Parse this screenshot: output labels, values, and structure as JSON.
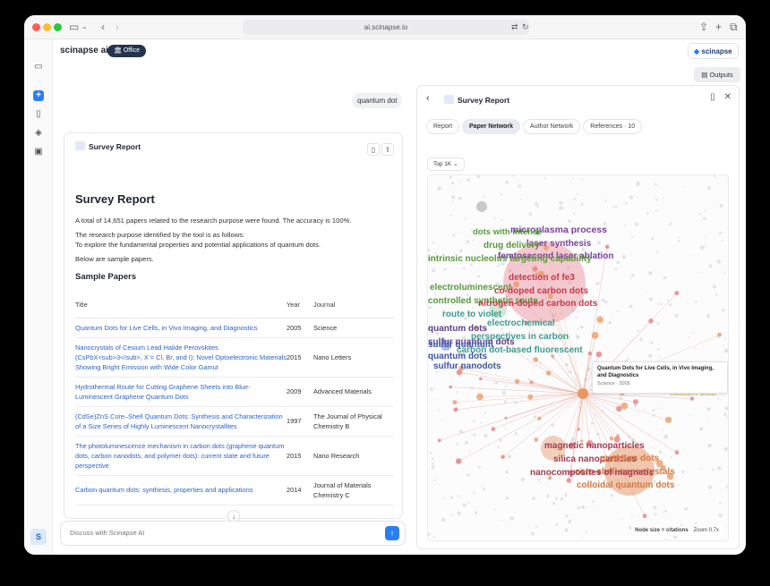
{
  "window": {
    "url": "ai.scinapse.io"
  },
  "header": {
    "brand": "scinapse ai",
    "workspace_badge": "🏛 Office",
    "scinapse_button": "scinapse",
    "outputs_button": "Outputs"
  },
  "rail": {
    "avatar": "S"
  },
  "chat": {
    "query": "quantum dot",
    "card_title": "Survey Report",
    "report": {
      "title": "Survey Report",
      "summary": "A total of 14,651 papers related to the research purpose were found. The accuracy is 100%.",
      "purpose_intro": "The research purpose identified by the tool is as follows:",
      "purpose": "To explore the fundamental properties and potential applications of quantum dots.",
      "below": "Below are sample papers.",
      "sample_title": "Sample Papers",
      "columns": [
        "Title",
        "Year",
        "Journal"
      ],
      "rows": [
        {
          "title": "Quantum Dots for Live Cells, in Vivo Imaging, and Diagnostics",
          "year": "2005",
          "journal": "Science"
        },
        {
          "title": "Nanocrystals of Cesium Lead Halide Perovskites (CsPbX<sub>3</sub>, X = Cl, Br, and I): Novel Optoelectronic Materials Showing Bright Emission with Wide Color Gamut",
          "year": "2015",
          "journal": "Nano Letters"
        },
        {
          "title": "Hydrothermal Route for Cutting Graphene Sheets into Blue-Luminescent Graphene Quantum Dots",
          "year": "2009",
          "journal": "Advanced Materials"
        },
        {
          "title": "(CdSe)ZnS Core–Shell Quantum Dots: Synthesis and Characterization of a Size Series of Highly Luminescent Nanocrystallites",
          "year": "1997",
          "journal": "The Journal of Physical Chemistry B"
        },
        {
          "title": "The photoluminescence mechanism in carbon dots (graphene quantum dots, carbon nanodots, and polymer dots): current state and future perspective",
          "year": "2015",
          "journal": "Nano Research"
        },
        {
          "title": "Carbon quantum dots: synthesis, properties and applications",
          "year": "2014",
          "journal": "Journal of Materials Chemistry C"
        }
      ]
    },
    "composer_placeholder": "Discuss with Scinapse AI"
  },
  "panel": {
    "title": "Survey Report",
    "tabs": [
      "Report",
      "Paper Network",
      "Author Network",
      "References · 10"
    ],
    "active_tab": 1,
    "topk": "Top 1K",
    "graph_labels": [
      {
        "text": "microplasma process",
        "color": "#7b3f9e"
      },
      {
        "text": "dots with intense",
        "color": "#5a9a3a"
      },
      {
        "text": "laser synthesis",
        "color": "#7b3f9e"
      },
      {
        "text": "drug delivery",
        "color": "#5a9a3a"
      },
      {
        "text": "femtosecond laser ablation",
        "color": "#7b3f9e"
      },
      {
        "text": "intrinsic nucleolus targeting capability",
        "color": "#5a9a3a"
      },
      {
        "text": "detection of fe3",
        "color": "#c9394a"
      },
      {
        "text": "electroluminescent",
        "color": "#5a9a3a"
      },
      {
        "text": "co-doped carbon dots",
        "color": "#c9394a"
      },
      {
        "text": "controlled synthetic route",
        "color": "#5a9a3a"
      },
      {
        "text": "nitrogen-doped carbon dots",
        "color": "#c9394a"
      },
      {
        "text": "route to violet",
        "color": "#3f9b8f"
      },
      {
        "text": "electrochemical",
        "color": "#3f9b8f"
      },
      {
        "text": "quantum dots",
        "color": "#5b3f8e"
      },
      {
        "text": "perspectives in carbon",
        "color": "#3f9b8f"
      },
      {
        "text": "sulfur quantum dots",
        "color": "#5b3f8e"
      },
      {
        "text": "carbon dot-based fluorescent",
        "color": "#3f9b8f"
      },
      {
        "text": "sulfur quantum",
        "color": "#3d56a3"
      },
      {
        "text": "quantum dots",
        "color": "#3d56a3"
      },
      {
        "text": "sulfur nanodots",
        "color": "#3d56a3"
      },
      {
        "text": "cesium lead",
        "color": "#d9c66a"
      },
      {
        "text": "perovskite quantum",
        "color": "#d9c66a"
      },
      {
        "text": "lead halide perovskite",
        "color": "#d9c66a"
      },
      {
        "text": "magnetic nanoparticles",
        "color": "#a33a4f"
      },
      {
        "text": "silica nanoparticles",
        "color": "#a33a4f"
      },
      {
        "text": "quantum dots",
        "color": "#d9773a"
      },
      {
        "text": "core-shell nanocrystals",
        "color": "#d9773a"
      },
      {
        "text": "nanocomposites of magnetic",
        "color": "#a33a4f"
      },
      {
        "text": "colloidal quantum dots",
        "color": "#d9773a"
      }
    ],
    "tooltip": {
      "title": "Quantum Dots for Live Cells, in Vivo Imaging, and Diagnostics",
      "meta": "Science · 2005"
    },
    "legend": {
      "size": "Node size = citations",
      "zoom": "Zoom 0.7x"
    }
  }
}
